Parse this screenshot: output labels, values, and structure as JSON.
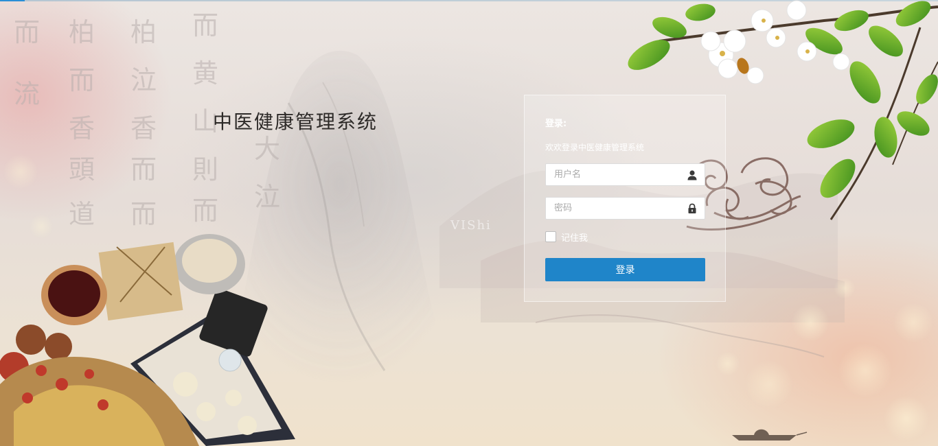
{
  "page": {
    "title": "中医健康管理系统",
    "watermark": "VIShi"
  },
  "login": {
    "heading": "登录:",
    "welcome": "欢欢登录中医健康管理系统",
    "username": {
      "value": "",
      "placeholder": "用户名",
      "icon": "user-icon"
    },
    "password": {
      "value": "",
      "placeholder": "密码",
      "icon": "lock-icon"
    },
    "remember_label": "记住我",
    "remember_checked": false,
    "submit_label": "登录"
  },
  "colors": {
    "accent": "#1f85c9",
    "top_line": "#2a8fd6",
    "title_text": "#2d2a28"
  },
  "decor": {
    "calligraphy_glyphs": [
      "柏",
      "而",
      "黄",
      "香",
      "山",
      "大",
      "而",
      "则",
      "道",
      "而"
    ]
  }
}
